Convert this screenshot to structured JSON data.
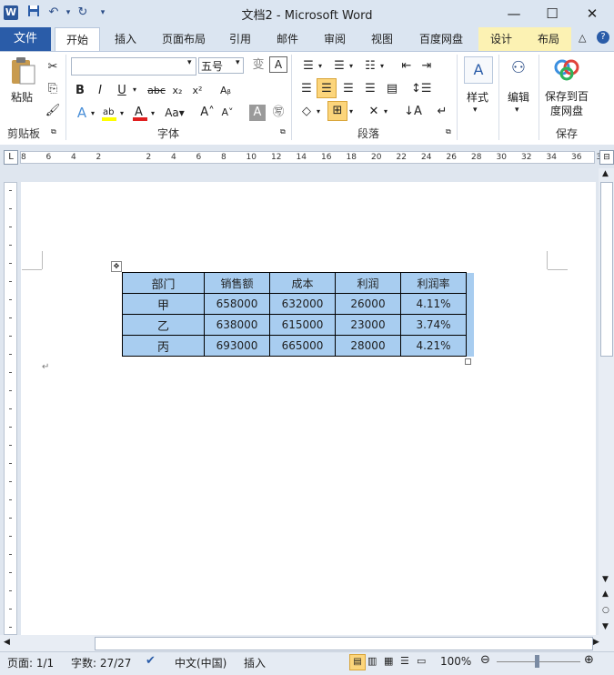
{
  "app": {
    "title": "文档2 - Microsoft Word",
    "icon": "word-icon"
  },
  "quick_access": [
    "save-icon",
    "undo-icon",
    "redo-icon",
    "customize-icon"
  ],
  "tabs": [
    {
      "label": "文件"
    },
    {
      "label": "开始"
    },
    {
      "label": "插入"
    },
    {
      "label": "页面布局"
    },
    {
      "label": "引用"
    },
    {
      "label": "邮件"
    },
    {
      "label": "审阅"
    },
    {
      "label": "视图"
    },
    {
      "label": "百度网盘"
    },
    {
      "label": "设计"
    },
    {
      "label": "布局"
    }
  ],
  "ribbon": {
    "clipboard": {
      "label": "剪贴板",
      "paste": "粘贴"
    },
    "font": {
      "label": "字体",
      "font_name": "",
      "font_size": "五号"
    },
    "paragraph": {
      "label": "段落"
    },
    "styles": {
      "label": "样式"
    },
    "editing": {
      "label": "编辑"
    },
    "save": {
      "label": "保存",
      "button": "保存到百度网盘"
    }
  },
  "ruler": {
    "ticks": [
      "8",
      "6",
      "4",
      "2",
      "",
      "2",
      "4",
      "6",
      "8",
      "10",
      "12",
      "14",
      "16",
      "18",
      "20",
      "22",
      "24",
      "26",
      "28",
      "30",
      "32",
      "34",
      "36",
      "38"
    ]
  },
  "table": {
    "headers": [
      "部门",
      "销售额",
      "成本",
      "利润",
      "利润率"
    ],
    "rows": [
      [
        "甲",
        "658000",
        "632000",
        "26000",
        "4.11%"
      ],
      [
        "乙",
        "638000",
        "615000",
        "23000",
        "3.74%"
      ],
      [
        "丙",
        "693000",
        "665000",
        "28000",
        "4.21%"
      ]
    ]
  },
  "status": {
    "page": "页面: 1/1",
    "words": "字数: 27/27",
    "language": "中文(中国)",
    "mode": "插入",
    "zoom": "100%"
  }
}
